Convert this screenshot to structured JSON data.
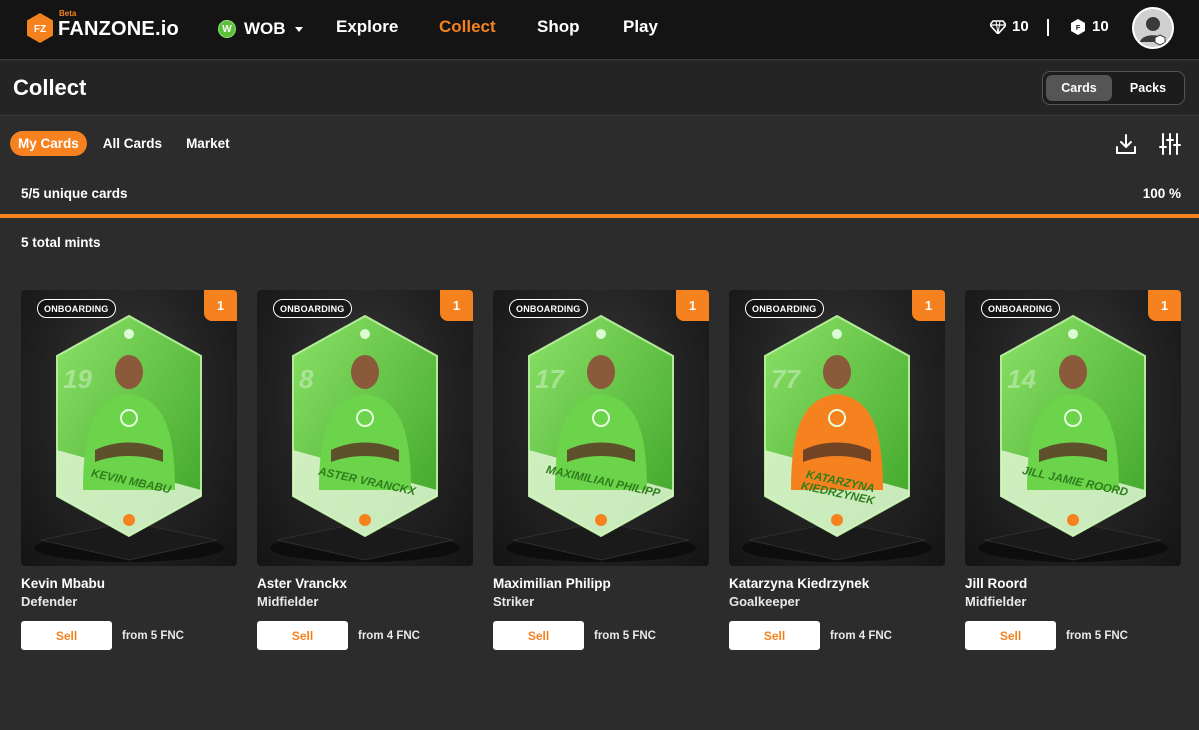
{
  "nav": {
    "logo_text": "FANZONE.io",
    "logo_badge": "FZ",
    "beta_label": "Beta",
    "club": {
      "label": "WOB",
      "badge": "W"
    },
    "links": [
      {
        "label": "Explore",
        "active": false
      },
      {
        "label": "Collect",
        "active": true
      },
      {
        "label": "Shop",
        "active": false
      },
      {
        "label": "Play",
        "active": false
      }
    ],
    "wallet": {
      "gems": "10",
      "coins": "10"
    },
    "accent_color": "#f5821f"
  },
  "header": {
    "title": "Collect",
    "toggle": [
      {
        "label": "Cards",
        "active": true
      },
      {
        "label": "Packs",
        "active": false
      }
    ]
  },
  "filters": {
    "tabs": [
      {
        "label": "My Cards",
        "active": true
      },
      {
        "label": "All Cards",
        "active": false
      },
      {
        "label": "Market",
        "active": false
      }
    ],
    "icons": [
      "download-icon",
      "filter-sliders-icon"
    ]
  },
  "collection": {
    "unique_label": "5/5 unique cards",
    "percent_label": "100 %",
    "progress_fraction": 1.0,
    "mints_label": "5 total mints"
  },
  "cards": [
    {
      "badge": "ONBOARDING",
      "count": "1",
      "number": "19",
      "nameplate": "KEVIN MBABU",
      "name": "Kevin Mbabu",
      "position": "Defender",
      "sell_label": "Sell",
      "price": "from 5 FNC",
      "jersey_color": "#6cd44a"
    },
    {
      "badge": "ONBOARDING",
      "count": "1",
      "number": "8",
      "nameplate": "ASTER VRANCKX",
      "name": "Aster Vranckx",
      "position": "Midfielder",
      "sell_label": "Sell",
      "price": "from 4 FNC",
      "jersey_color": "#6cd44a"
    },
    {
      "badge": "ONBOARDING",
      "count": "1",
      "number": "17",
      "nameplate": "MAXIMILIAN PHILIPP",
      "name": "Maximilian Philipp",
      "position": "Striker",
      "sell_label": "Sell",
      "price": "from 5 FNC",
      "jersey_color": "#6cd44a"
    },
    {
      "badge": "ONBOARDING",
      "count": "1",
      "number": "77",
      "nameplate": "KATARZYNA KIEDRZYNEK",
      "name": "Katarzyna Kiedrzynek",
      "position": "Goalkeeper",
      "sell_label": "Sell",
      "price": "from 4 FNC",
      "jersey_color": "#f5821f"
    },
    {
      "badge": "ONBOARDING",
      "count": "1",
      "number": "14",
      "nameplate": "JILL JAMIE ROORD",
      "name": "Jill Roord",
      "position": "Midfielder",
      "sell_label": "Sell",
      "price": "from 5 FNC",
      "jersey_color": "#6cd44a"
    }
  ]
}
